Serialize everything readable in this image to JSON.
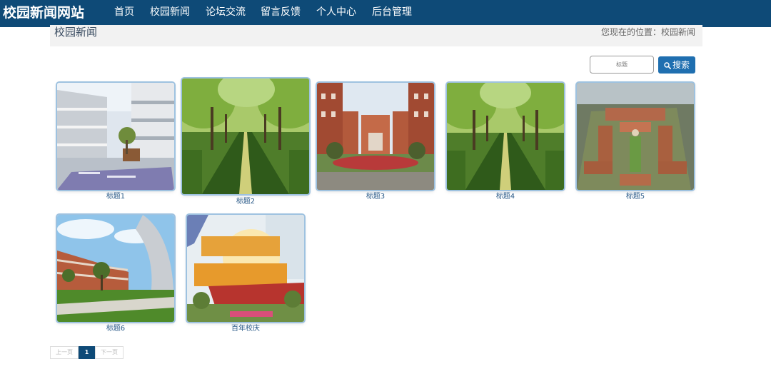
{
  "header": {
    "brand": "校园新闻网站",
    "nav": [
      {
        "label": "首页",
        "active": false
      },
      {
        "label": "校园新闻",
        "active": true
      },
      {
        "label": "论坛交流",
        "active": false
      },
      {
        "label": "留言反馈",
        "active": false
      },
      {
        "label": "个人中心",
        "active": false
      },
      {
        "label": "后台管理",
        "active": false
      }
    ]
  },
  "breadcrumb": {
    "title": "校园新闻",
    "location": "您现在的位置：校园新闻"
  },
  "search": {
    "placeholder": "标题",
    "button_label": "搜索"
  },
  "news": [
    {
      "title": "标题1",
      "image": "campus-building-courtyard"
    },
    {
      "title": "标题2",
      "image": "tree-lined-avenue"
    },
    {
      "title": "标题3",
      "image": "red-brick-campus-gate"
    },
    {
      "title": "标题4",
      "image": "tree-lined-avenue"
    },
    {
      "title": "标题5",
      "image": "campus-aerial-view"
    },
    {
      "title": "标题6",
      "image": "curved-building-lawn"
    },
    {
      "title": "百年校庆",
      "image": "anniversary-sign"
    }
  ],
  "pagination": {
    "prev_label": "上一页",
    "current_page": "1",
    "next_label": "下一页"
  },
  "colors": {
    "navbar": "#0e4a77",
    "search_button": "#1f6fb0",
    "caption": "#2a5a88"
  }
}
